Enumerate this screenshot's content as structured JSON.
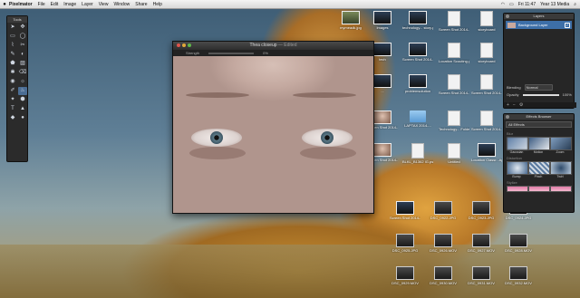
{
  "menubar": {
    "apple": "",
    "app_name": "Pixelmator",
    "items": [
      "File",
      "Edit",
      "Image",
      "Layer",
      "View",
      "Window",
      "Share",
      "Help"
    ],
    "clock": "Fri 11:47",
    "user": "Year 13 Media"
  },
  "tools": {
    "title": "Tools",
    "icons": [
      "➤",
      "✥",
      "▭",
      "◯",
      "⌇",
      "✂",
      "✎",
      "◐",
      "⬟",
      "▨",
      "✱",
      "⌫",
      "◉",
      "☼",
      "✐",
      "♨",
      "✦",
      "⬢",
      "T",
      "▲",
      "◆",
      "●"
    ]
  },
  "image_window": {
    "title": "Thea closeup",
    "edited_suffix": "— Edited",
    "option_labels": [
      "Strength",
      "0%"
    ]
  },
  "desktop_icons": [
    {
      "label": "mymeadk.jpg",
      "kind": "photo2"
    },
    {
      "label": "Images",
      "kind": "shot"
    },
    {
      "label": "technology... story.pdf",
      "kind": "shot"
    },
    {
      "label": "Screen Shot 2014-...0.58.07",
      "kind": "doc"
    },
    {
      "label": "storyboard",
      "kind": "doc"
    },
    {
      "label": "tech",
      "kind": "shot"
    },
    {
      "label": "Screen Shot 2014-...5.48.55",
      "kind": "shot"
    },
    {
      "label": "Location Scouting.pdf",
      "kind": "doc"
    },
    {
      "label": "storyboard",
      "kind": "doc"
    },
    {
      "label": "...",
      "kind": "shot"
    },
    {
      "label": "problemsolution",
      "kind": "shot"
    },
    {
      "label": "Screen Shot 2014-...2.48.08",
      "kind": "doc"
    },
    {
      "label": "Screen Shot 2014-...2.48.05",
      "kind": "doc"
    },
    {
      "label": "Screen Shot 2014-...12.23.26",
      "kind": "face"
    },
    {
      "label": "LAPTAX 2014-...",
      "kind": "folder"
    },
    {
      "label": "Technology... Folder",
      "kind": "doc"
    },
    {
      "label": "Screen Shot 2014-...12.15.08",
      "kind": "doc"
    },
    {
      "label": "Screen Shot 2014-...12.13.51",
      "kind": "face"
    },
    {
      "label": "BLKL_B1362 IG.psd",
      "kind": "doc"
    },
    {
      "label": "Untitled",
      "kind": "doc"
    },
    {
      "label": "Location Classr...Appt",
      "kind": "shot"
    },
    {
      "label": "Screen Shot 2014-...",
      "kind": "shot"
    },
    {
      "label": "DSC_0922.JPG",
      "kind": "video"
    },
    {
      "label": "DSC_0923.JPG",
      "kind": "video"
    },
    {
      "label": "DSC_0924.JPG",
      "kind": "video"
    },
    {
      "label": "DSC_0925.JPG",
      "kind": "video"
    },
    {
      "label": "DSC_0926.MOV",
      "kind": "video"
    },
    {
      "label": "DSC_0927.MOV",
      "kind": "video"
    },
    {
      "label": "DSC_0928.MOV",
      "kind": "video"
    },
    {
      "label": "DSC_0929.MOV",
      "kind": "video"
    },
    {
      "label": "DSC_0930.MOV",
      "kind": "video"
    },
    {
      "label": "DSC_0931.MOV",
      "kind": "video"
    },
    {
      "label": "DSC_0932.MOV",
      "kind": "video"
    }
  ],
  "layers": {
    "title": "Layers",
    "layer_name": "Background Layer",
    "blending_label": "Blending",
    "blending_value": "Normal",
    "opacity_label": "Opacity",
    "opacity_value": "100%",
    "opacity_level": 1.0,
    "footer": [
      "+",
      "−",
      "⚙"
    ]
  },
  "effects": {
    "title": "Effects Browser",
    "filter_value": "All Effects",
    "group1": "Blur",
    "blur_items": [
      "Gaussian",
      "Motion",
      "Zoom"
    ],
    "group2": "Distortion",
    "distort_items": [
      "Bump",
      "Pinch",
      "Twirl"
    ],
    "group3": "Stylize",
    "colors": {
      "accent": "#3d6fa8",
      "panel": "#262626"
    }
  }
}
